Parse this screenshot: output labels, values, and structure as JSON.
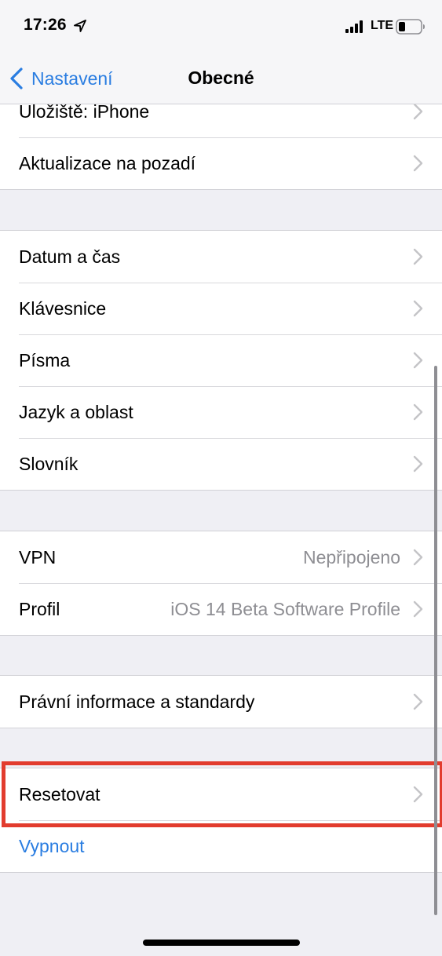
{
  "status_bar": {
    "time": "17:26",
    "network": "LTE",
    "icons": [
      "location-arrow-icon",
      "cellular-signal-icon",
      "battery-icon"
    ]
  },
  "nav": {
    "back_label": "Nastavení",
    "title": "Obecné"
  },
  "groups": [
    {
      "rows": [
        {
          "label": "Úložiště: iPhone"
        },
        {
          "label": "Aktualizace na pozadí"
        }
      ]
    },
    {
      "rows": [
        {
          "label": "Datum a čas"
        },
        {
          "label": "Klávesnice"
        },
        {
          "label": "Písma"
        },
        {
          "label": "Jazyk a oblast"
        },
        {
          "label": "Slovník"
        }
      ]
    },
    {
      "rows": [
        {
          "label": "VPN",
          "value": "Nepřipojeno"
        },
        {
          "label": "Profil",
          "value": "iOS 14 Beta Software Profile"
        }
      ]
    },
    {
      "rows": [
        {
          "label": "Právní informace a standardy"
        }
      ]
    },
    {
      "rows": [
        {
          "label": "Resetovat"
        },
        {
          "label": "Vypnout"
        }
      ]
    }
  ],
  "colors": {
    "accent": "#2a7de1",
    "highlight": "#e23c2e",
    "background": "#efeff4",
    "secondary_text": "#8e8e93"
  }
}
